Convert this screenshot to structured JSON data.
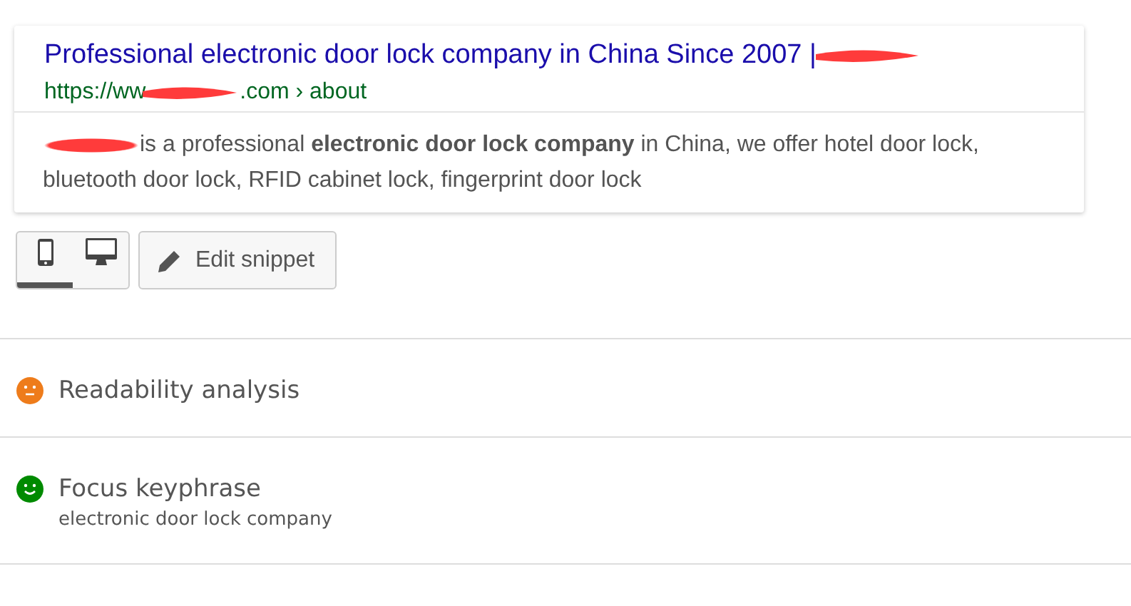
{
  "snippet": {
    "title": "Professional electronic door lock company in China Since 2007 |",
    "url_start": "https://ww",
    "url_end": ".com › about",
    "description": "is a professional **electronic door lock company** in China, we offer hotel door lock, bluetooth door lock, RFID cabinet lock, fingerprint door lock"
  },
  "device_toggle": [
    {
      "kind": "mobile",
      "selected": true
    },
    {
      "kind": "desktop",
      "selected": false
    }
  ],
  "edit_button": {
    "label": "Edit snippet"
  },
  "sections": [
    {
      "title": "Readability analysis",
      "kind": "neutral",
      "color": "#ee7c1b"
    },
    {
      "title": "Focus keyphrase",
      "kind": "happy",
      "color": "#008a00",
      "subtitle": "electronic door lock company"
    }
  ]
}
